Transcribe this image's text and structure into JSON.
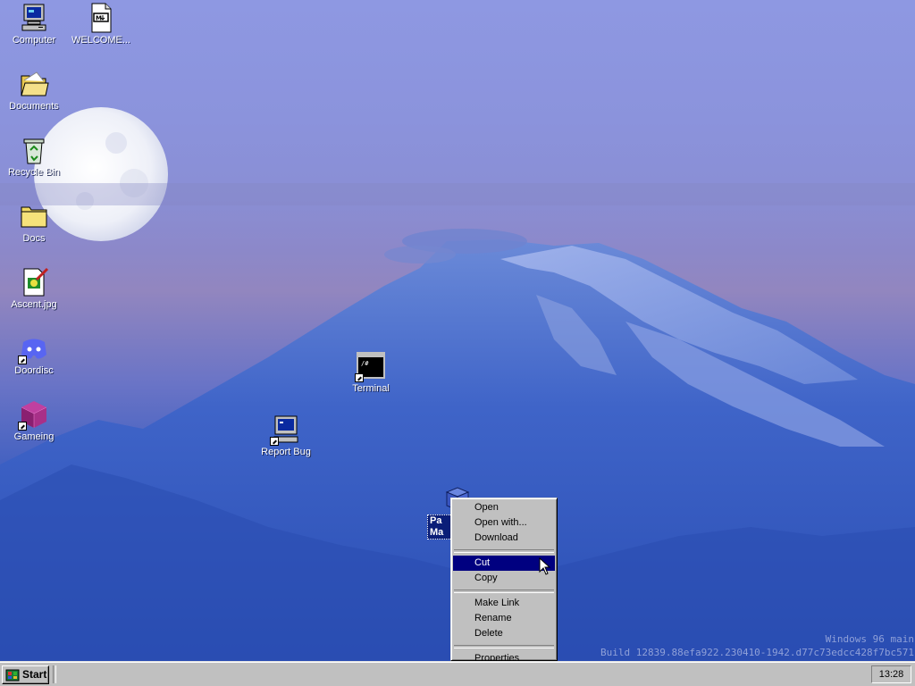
{
  "desktop": {
    "icons": [
      {
        "name": "Computer",
        "icon": "computer-icon"
      },
      {
        "name": "WELCOME...",
        "icon": "markdown-file-icon"
      },
      {
        "name": "Documents",
        "icon": "open-folder-icon"
      },
      {
        "name": "Recycle Bin",
        "icon": "recycle-bin-icon"
      },
      {
        "name": "Docs",
        "icon": "folder-icon"
      },
      {
        "name": "Ascent.jpg",
        "icon": "image-file-icon"
      },
      {
        "name": "Doordisc",
        "icon": "discord-icon"
      },
      {
        "name": "Gameing",
        "icon": "cube-game-icon"
      },
      {
        "name": "Terminal",
        "icon": "terminal-icon"
      },
      {
        "name": "Report Bug",
        "icon": "report-bug-computer-icon"
      },
      {
        "name": "Pa Ma",
        "label_line1": "Pa",
        "label_line2": "Ma",
        "icon": "package-icon"
      }
    ]
  },
  "context_menu": {
    "group1": [
      "Open",
      "Open with...",
      "Download"
    ],
    "group2": [
      "Cut",
      "Copy"
    ],
    "group3": [
      "Make Link",
      "Rename",
      "Delete"
    ],
    "group4": [
      "Properties"
    ],
    "highlighted": "Cut"
  },
  "watermark": {
    "line1": "Windows 96 main",
    "line2": "Build 12839.88efa922.230410-1942.d77c73edcc428f7bc571"
  },
  "taskbar": {
    "start_label": "Start",
    "clock": "13:28"
  },
  "colors": {
    "taskbar": "#c0c0c0",
    "menu_highlight": "#000080",
    "selection": "#0a1e78"
  }
}
